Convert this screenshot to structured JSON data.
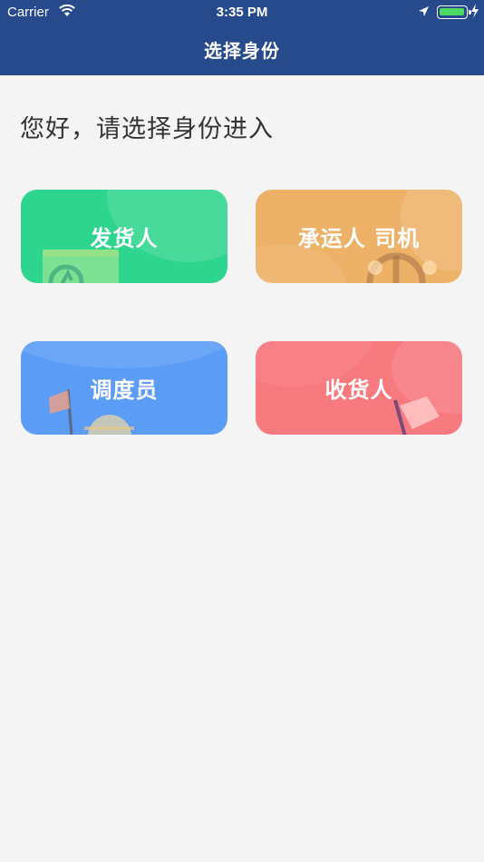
{
  "status_bar": {
    "carrier": "Carrier",
    "time": "3:35 PM"
  },
  "nav": {
    "title": "选择身份"
  },
  "greeting": "您好，请选择身份进入",
  "roles": {
    "shipper": {
      "label": "发货人",
      "color": "#2ed58e"
    },
    "driver": {
      "label": "承运人 司机",
      "color": "#edb168"
    },
    "dispatcher": {
      "label": "调度员",
      "color": "#5b9cf7"
    },
    "receiver": {
      "label": "收货人",
      "color": "#f77a7f"
    }
  },
  "colors": {
    "header": "#264a8c",
    "background": "#f4f4f4",
    "battery": "#4cd964"
  }
}
